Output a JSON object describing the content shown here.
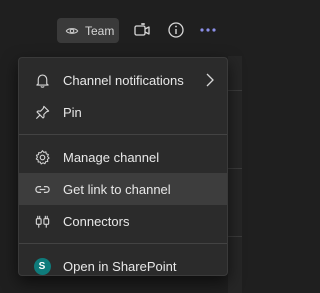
{
  "header": {
    "team_label": "Team",
    "icons": [
      "eye-icon",
      "meet-now-icon",
      "info-icon",
      "more-options-icon"
    ],
    "accent": "#8b8fe8"
  },
  "menu": {
    "items": [
      {
        "label": "Channel notifications",
        "icon": "bell-icon",
        "submenu": true
      },
      {
        "label": "Pin",
        "icon": "pin-icon"
      },
      {
        "label": "Manage channel",
        "icon": "gear-icon"
      },
      {
        "label": "Get link to channel",
        "icon": "link-icon",
        "active": true
      },
      {
        "label": "Connectors",
        "icon": "connector-plug-icon"
      },
      {
        "label": "Open in SharePoint",
        "icon": "sharepoint-icon",
        "badge": "S"
      }
    ]
  },
  "colors": {
    "background": "#1f1f1f",
    "menu_bg": "#2b2b2b",
    "hover_bg": "#3d3d3d",
    "text": "#e8e8e8"
  }
}
